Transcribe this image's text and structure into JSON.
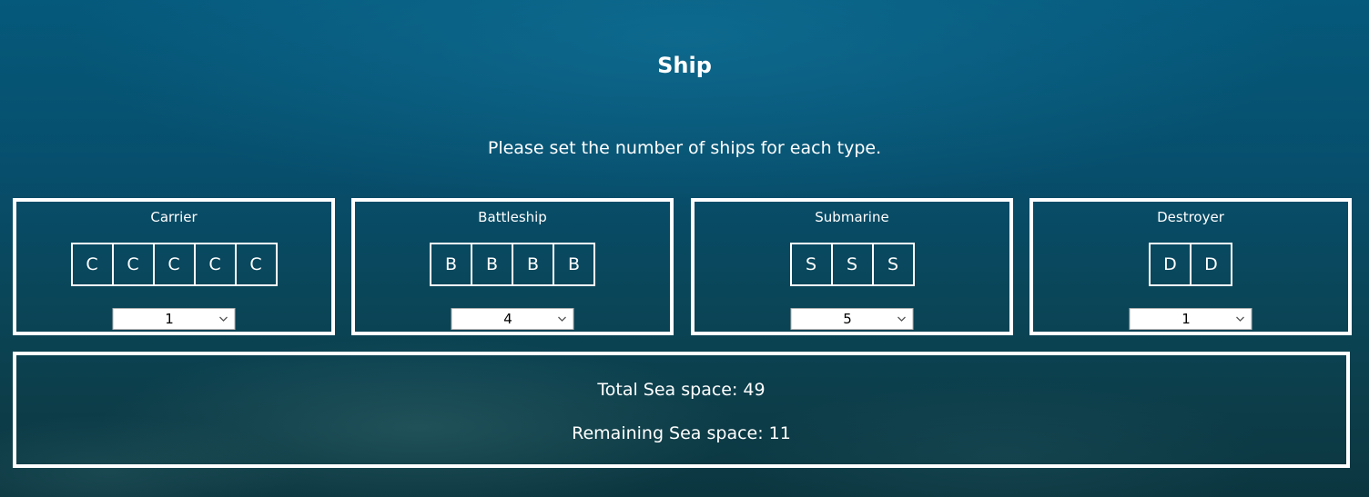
{
  "header": {
    "title": "Ship",
    "instructions": "Please set the number of ships for each type."
  },
  "ships": [
    {
      "name": "Carrier",
      "cells": [
        "C",
        "C",
        "C",
        "C",
        "C"
      ],
      "count": "1"
    },
    {
      "name": "Battleship",
      "cells": [
        "B",
        "B",
        "B",
        "B"
      ],
      "count": "4"
    },
    {
      "name": "Submarine",
      "cells": [
        "S",
        "S",
        "S"
      ],
      "count": "5"
    },
    {
      "name": "Destroyer",
      "cells": [
        "D",
        "D"
      ],
      "count": "1"
    }
  ],
  "summary": {
    "total": "Total Sea space: 49",
    "remaining": "Remaining Sea space: 11"
  },
  "icons": {
    "select_arrow": "chevron-down-icon"
  },
  "colors": {
    "text": "#ffffff",
    "border": "#ffffff",
    "background": "#074e6c"
  }
}
